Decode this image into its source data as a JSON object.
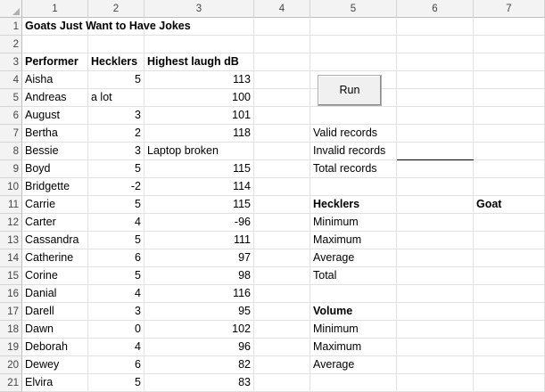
{
  "columns": [
    "1",
    "2",
    "3",
    "4",
    "5",
    "6",
    "7"
  ],
  "rows": [
    "1",
    "2",
    "3",
    "4",
    "5",
    "6",
    "7",
    "8",
    "9",
    "10",
    "11",
    "12",
    "13",
    "14",
    "15",
    "16",
    "17",
    "18",
    "19",
    "20",
    "21"
  ],
  "title": "Goats Just Want to Have Jokes",
  "table": {
    "headers": [
      "Performer",
      "Hecklers",
      "Highest laugh dB"
    ],
    "records": [
      [
        "Aisha",
        "5",
        "113"
      ],
      [
        "Andreas",
        "a lot",
        "100"
      ],
      [
        "August",
        "3",
        "101"
      ],
      [
        "Bertha",
        "2",
        "118"
      ],
      [
        "Bessie",
        "3",
        "Laptop broken"
      ],
      [
        "Boyd",
        "5",
        "115"
      ],
      [
        "Bridgette",
        "-2",
        "114"
      ],
      [
        "Carrie",
        "5",
        "115"
      ],
      [
        "Carter",
        "4",
        "-96"
      ],
      [
        "Cassandra",
        "5",
        "111"
      ],
      [
        "Catherine",
        "6",
        "97"
      ],
      [
        "Corine",
        "5",
        "98"
      ],
      [
        "Danial",
        "4",
        "116"
      ],
      [
        "Darell",
        "3",
        "95"
      ],
      [
        "Dawn",
        "0",
        "102"
      ],
      [
        "Deborah",
        "4",
        "96"
      ],
      [
        "Dewey",
        "6",
        "82"
      ],
      [
        "Elvira",
        "5",
        "83"
      ]
    ]
  },
  "run_button": "Run",
  "summary": {
    "valid": "Valid records",
    "invalid": "Invalid records",
    "total": "Total records",
    "hecklers_heading": "Hecklers",
    "goat_heading": "Goat",
    "h_min": "Minimum",
    "h_max": "Maximum",
    "h_avg": "Average",
    "h_total": "Total",
    "volume_heading": "Volume",
    "v_min": "Minimum",
    "v_max": "Maximum",
    "v_avg": "Average"
  }
}
